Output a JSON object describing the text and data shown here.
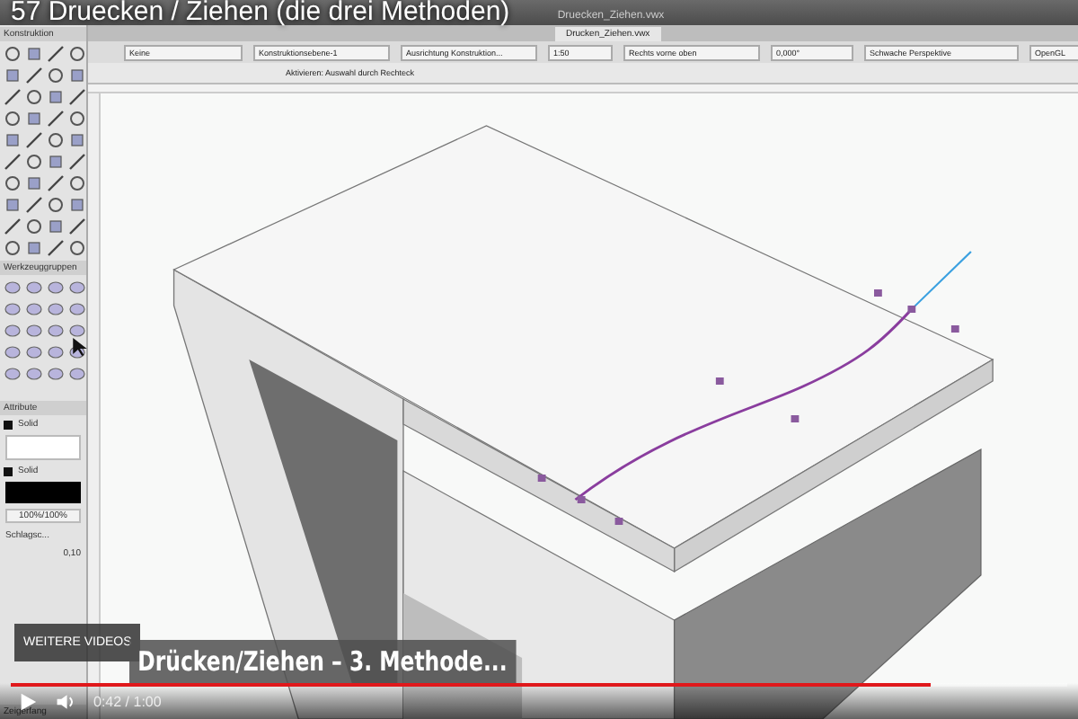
{
  "video": {
    "title": "57 Druecken / Ziehen (die drei Methoden)",
    "caption": "Drücken/Ziehen – 3. Methode...",
    "more_videos": "WEITERE VIDEOS",
    "time": "0:42 / 1:00",
    "progress": {
      "level": 0.87
    }
  },
  "app": {
    "window_title": "Druecken_Ziehen.vwx",
    "document_tab": "Drucken_Ziehen.vwx",
    "view_bar": [
      "Keine",
      "Konstruktionsebene-1",
      "Ausrichtung Konstruktion...",
      "1:50",
      "Rechts vorne oben",
      "0,000°",
      "Schwache Perspektive",
      "OpenGL"
    ],
    "mode_hint": "Aktivieren: Auswahl durch Rechteck",
    "palettes": {
      "construction": "Konstruktion",
      "tool_groups": "Werkzeuggruppen",
      "attributes": {
        "title": "Attribute",
        "fill_style": "Solid",
        "pen_style": "Solid",
        "opacity": "100%/100%",
        "shadow": "Schlagsc...",
        "line_weight": "0,10"
      },
      "snapping": "Zeigerfang"
    }
  }
}
